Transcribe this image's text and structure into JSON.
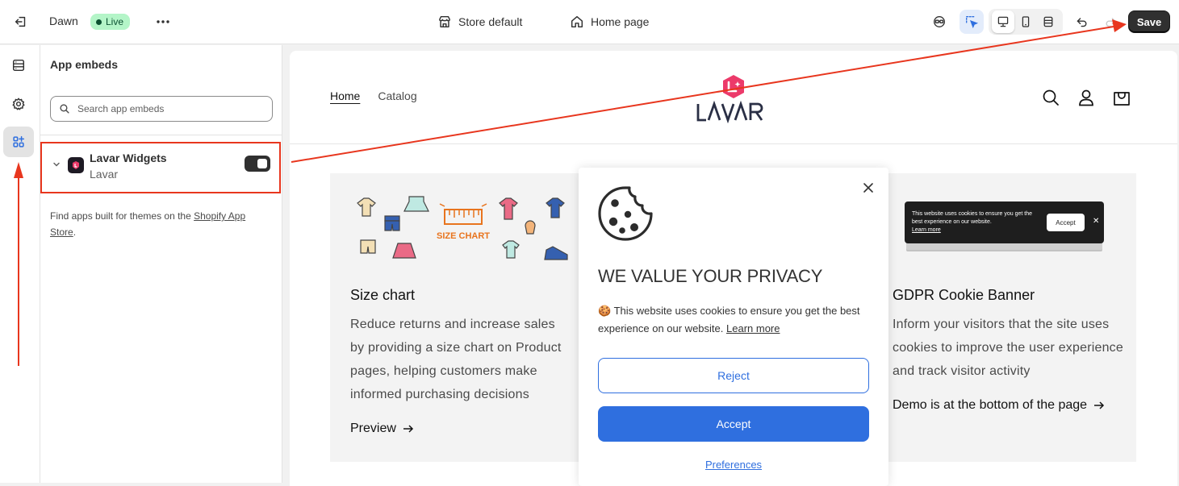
{
  "topbar": {
    "theme_name": "Dawn",
    "live_badge": "Live",
    "store_default": "Store default",
    "home_page": "Home page",
    "save_label": "Save"
  },
  "panel": {
    "title": "App embeds",
    "search_placeholder": "Search app embeds",
    "embed": {
      "name": "Lavar Widgets",
      "provider": "Lavar",
      "enabled": true
    },
    "find_apps_prefix": "Find apps built for themes on the ",
    "find_apps_link": "Shopify App Store",
    "find_apps_suffix": "."
  },
  "store": {
    "nav": [
      "Home",
      "Catalog"
    ],
    "logo_text": "LAVAR",
    "cards": [
      {
        "title": "Size chart",
        "description": "Reduce returns and increase sales by providing a size chart on Product pages, helping customers make informed purchasing decisions",
        "link": "Preview",
        "image_label": "SIZE CHART"
      },
      {
        "title": "GDPR Cookie Banner",
        "description": "Inform your visitors that the site uses cookies to improve the user experience and track visitor activity",
        "link": "Demo is at the bottom of the page"
      }
    ],
    "mini_banner": {
      "text": "This website uses cookies to ensure you get the best experience on our website.",
      "learn_more": "Learn more",
      "accept": "Accept",
      "close": "✕"
    }
  },
  "cookie_popup": {
    "heading": "WE VALUE YOUR PRIVACY",
    "message": "This website uses cookies to ensure you get the best experience on our website.",
    "learn_more": "Learn more",
    "reject": "Reject",
    "accept": "Accept",
    "preferences": "Preferences"
  },
  "colors": {
    "annotation_red": "#e8361e",
    "accent_blue": "#2f6fdf",
    "live_green": "#b4f5c8",
    "save_dark": "#303030",
    "logo_pink": "#ec3a6a"
  },
  "icons": [
    "exit-icon",
    "more-icon",
    "store-icon",
    "home-icon",
    "inspector-icon",
    "select-icon",
    "desktop-icon",
    "mobile-icon",
    "fullwidth-icon",
    "undo-icon",
    "redo-icon",
    "sections-icon",
    "settings-gear-icon",
    "apps-icon",
    "search-icon",
    "chevron-down-icon",
    "account-icon",
    "cart-icon",
    "cookie-icon",
    "close-icon",
    "arrow-right-icon"
  ]
}
